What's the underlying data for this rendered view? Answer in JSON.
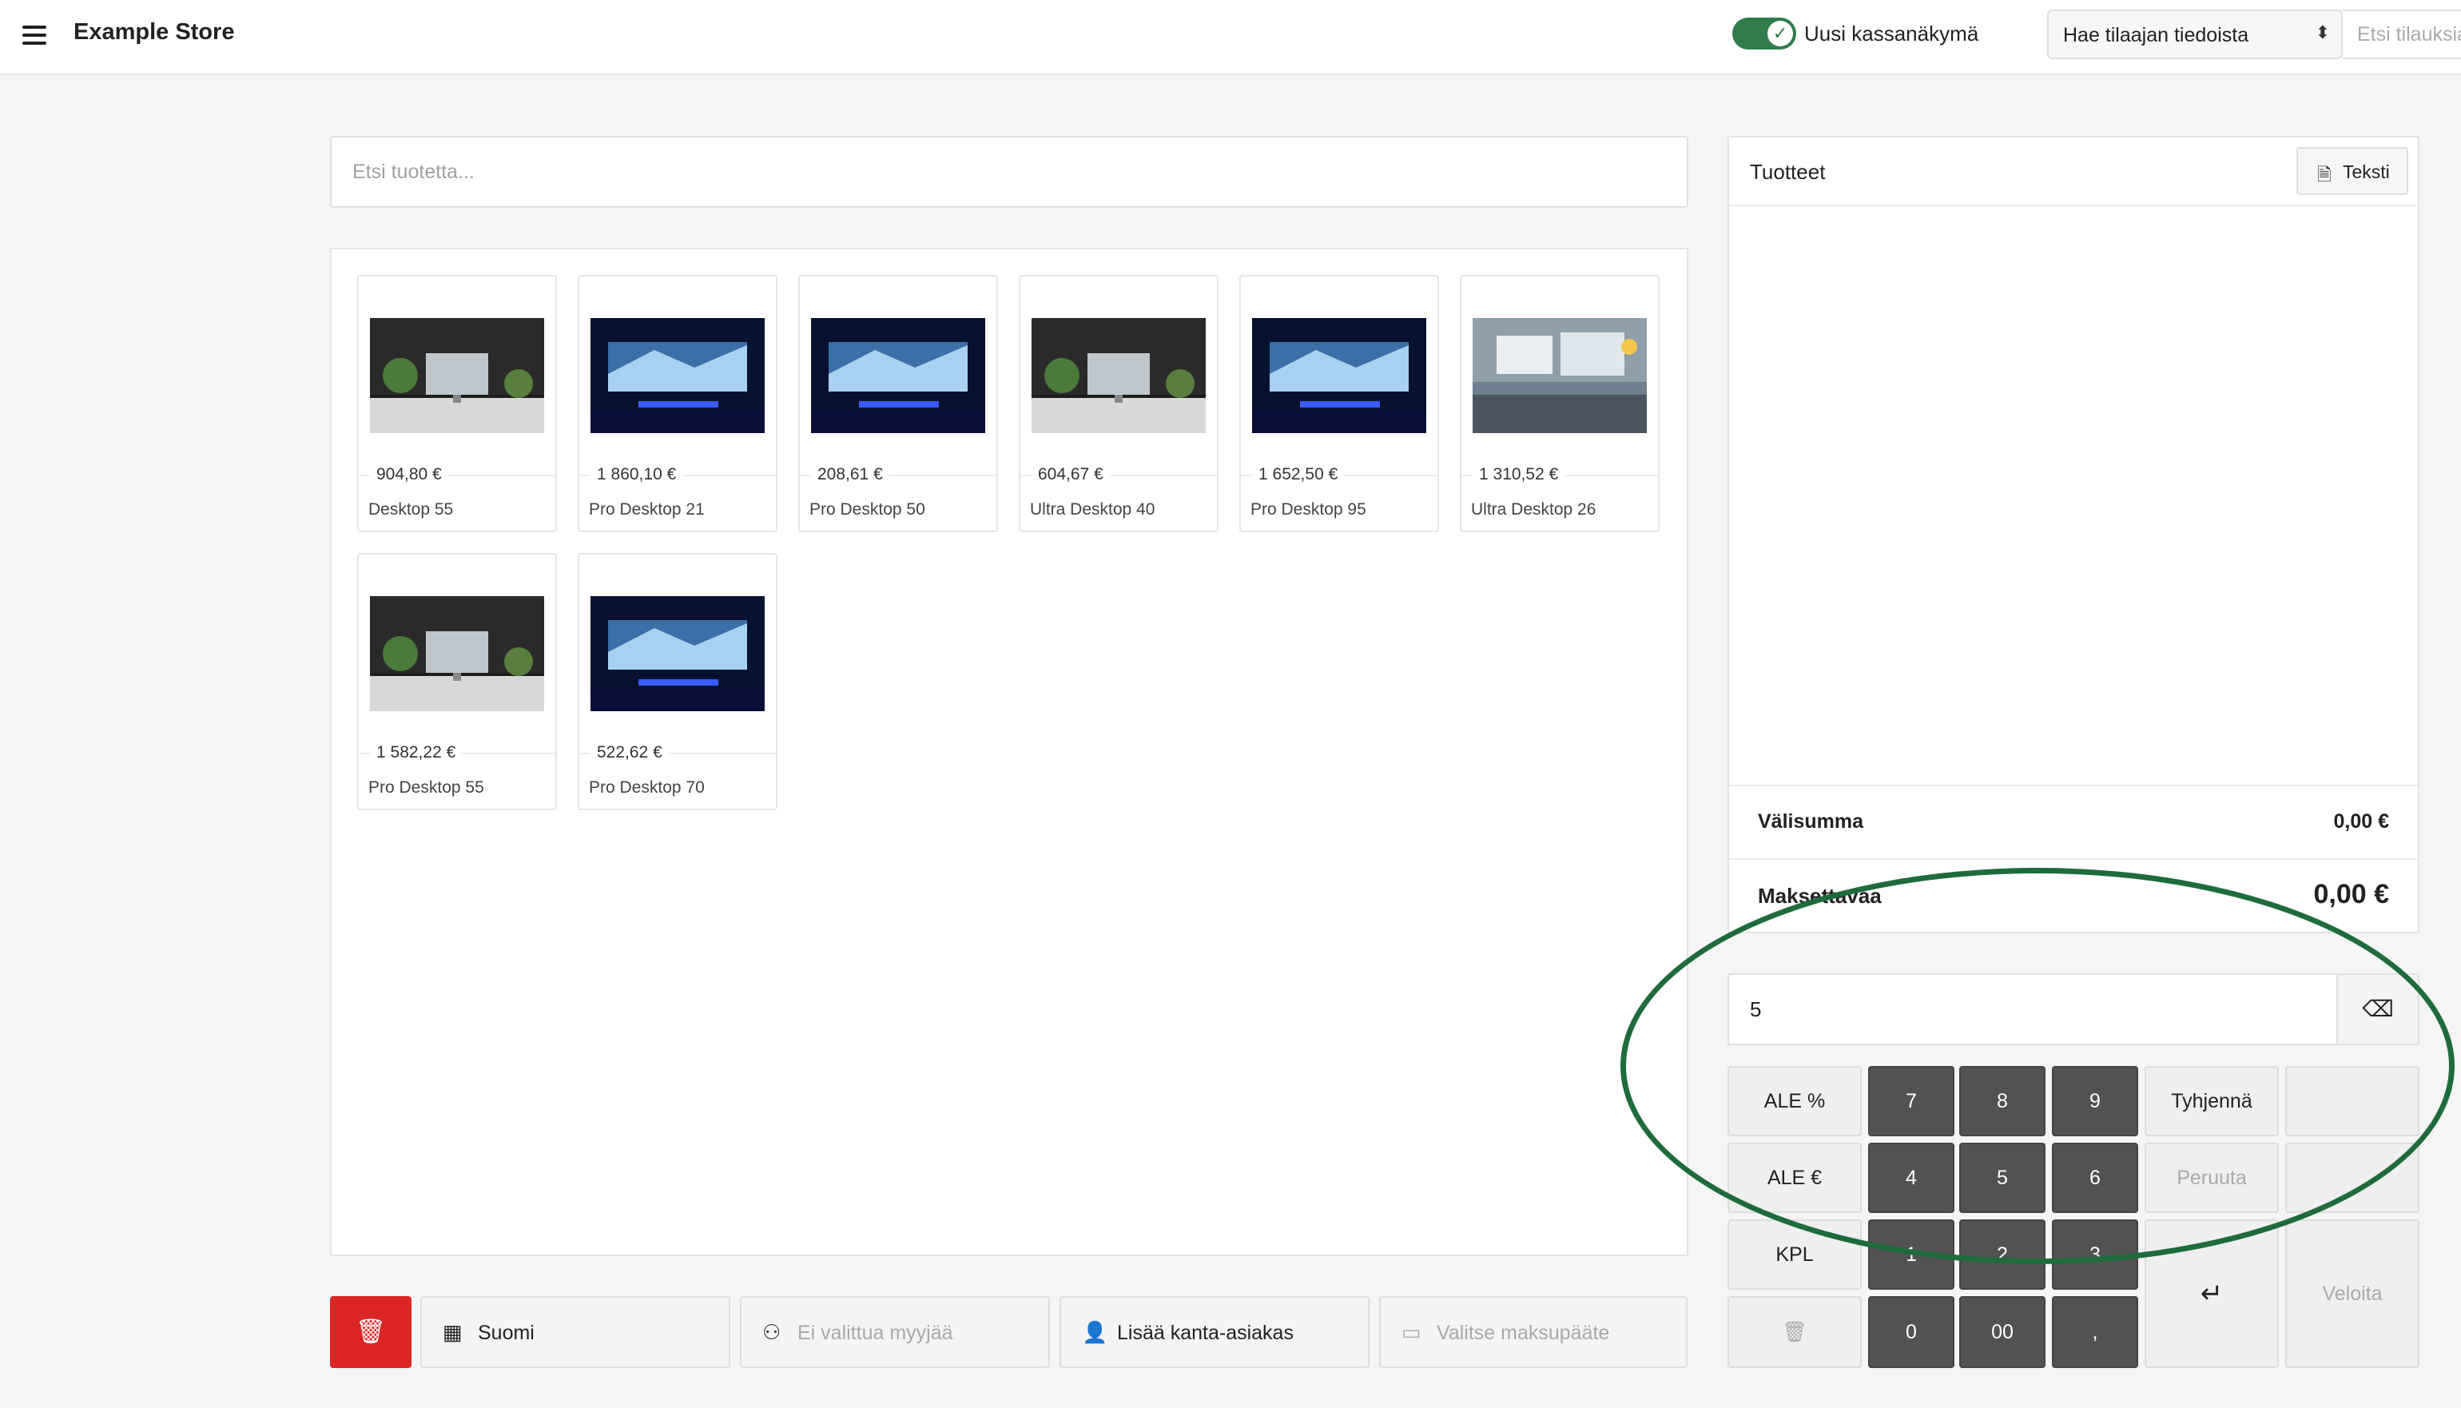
{
  "header": {
    "store_name": "Example Store",
    "toggle_label": "Uusi kassanäkymä",
    "toggle_on": true,
    "customer_select": "Hae tilaajan tiedoista",
    "order_search_placeholder": "Etsi tilauksia"
  },
  "product_search": {
    "placeholder": "Etsi tuotetta..."
  },
  "products": [
    {
      "price": "904,80 €",
      "name": "Desktop 55"
    },
    {
      "price": "1 860,10 €",
      "name": "Pro Desktop 21"
    },
    {
      "price": "208,61 €",
      "name": "Pro Desktop 50"
    },
    {
      "price": "604,67 €",
      "name": "Ultra Desktop 40"
    },
    {
      "price": "1 652,50 €",
      "name": "Pro Desktop 95"
    },
    {
      "price": "1 310,52 €",
      "name": "Ultra Desktop 26"
    },
    {
      "price": "1 582,22 €",
      "name": "Pro Desktop 55"
    },
    {
      "price": "522,62 €",
      "name": "Pro Desktop 70"
    }
  ],
  "bottom_bar": {
    "language": "Suomi",
    "seller": "Ei valittua myyjää",
    "customer": "Lisää kanta-asiakas",
    "terminal": "Valitse maksupääte"
  },
  "cart": {
    "title": "Tuotteet",
    "text_button": "Teksti",
    "subtotal_label": "Välisumma",
    "subtotal_value": "0,00 €",
    "total_label": "Maksettavaa",
    "total_value": "0,00 €"
  },
  "keypad": {
    "input_value": "5",
    "discount_pct": "ALE %",
    "discount_eur": "ALE €",
    "qty": "KPL",
    "clear": "Tyhjennä",
    "cancel": "Peruuta",
    "charge": "Veloita",
    "keys": [
      "7",
      "8",
      "9",
      "4",
      "5",
      "6",
      "1",
      "2",
      "3",
      "0",
      "00",
      ","
    ]
  },
  "colors": {
    "accent_green": "#2e7d4b",
    "delete_red": "#dc2626",
    "annotation_ellipse": "#1f6b3b"
  }
}
